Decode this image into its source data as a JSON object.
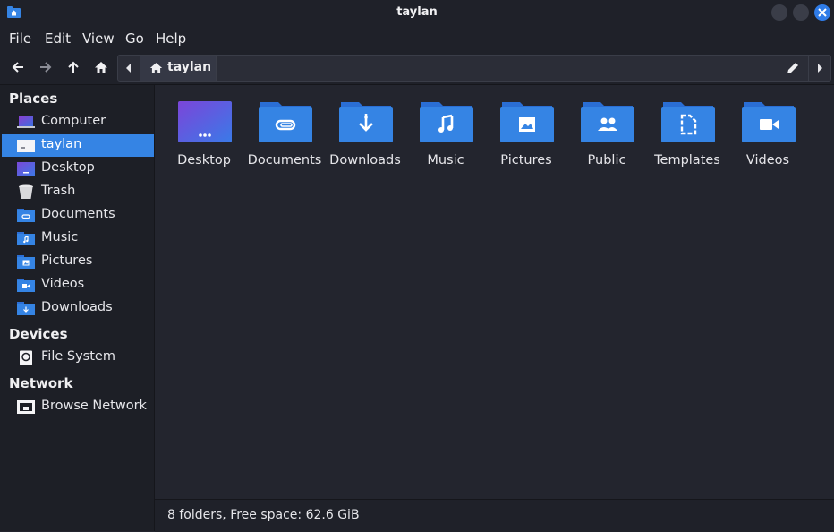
{
  "window": {
    "title": "taylan"
  },
  "menu": [
    "File",
    "Edit",
    "View",
    "Go",
    "Help"
  ],
  "path": {
    "current": "taylan"
  },
  "sidebar": {
    "places_header": "Places",
    "places": [
      {
        "label": "Computer",
        "icon": "laptop-icon"
      },
      {
        "label": "taylan",
        "icon": "home-folder-icon",
        "active": true
      },
      {
        "label": "Desktop",
        "icon": "desktop-folder-icon"
      },
      {
        "label": "Trash",
        "icon": "trash-icon"
      },
      {
        "label": "Documents",
        "icon": "documents-folder-icon"
      },
      {
        "label": "Music",
        "icon": "music-folder-icon"
      },
      {
        "label": "Pictures",
        "icon": "pictures-folder-icon"
      },
      {
        "label": "Videos",
        "icon": "videos-folder-icon"
      },
      {
        "label": "Downloads",
        "icon": "downloads-folder-icon"
      }
    ],
    "devices_header": "Devices",
    "devices": [
      {
        "label": "File System",
        "icon": "drive-icon"
      }
    ],
    "network_header": "Network",
    "network": [
      {
        "label": "Browse Network",
        "icon": "network-icon"
      }
    ]
  },
  "folders": [
    {
      "label": "Desktop",
      "icon": "desktop-folder-icon"
    },
    {
      "label": "Documents",
      "icon": "documents-folder-icon"
    },
    {
      "label": "Downloads",
      "icon": "downloads-folder-icon"
    },
    {
      "label": "Music",
      "icon": "music-folder-icon"
    },
    {
      "label": "Pictures",
      "icon": "pictures-folder-icon"
    },
    {
      "label": "Public",
      "icon": "public-folder-icon"
    },
    {
      "label": "Templates",
      "icon": "templates-folder-icon"
    },
    {
      "label": "Videos",
      "icon": "videos-folder-icon"
    }
  ],
  "status": {
    "text": "8 folders, Free space: 62.6 GiB"
  },
  "colors": {
    "accent": "#3584e4",
    "folder": "#3584e4",
    "background": "#23252e",
    "sidebar": "#1d1f26"
  }
}
